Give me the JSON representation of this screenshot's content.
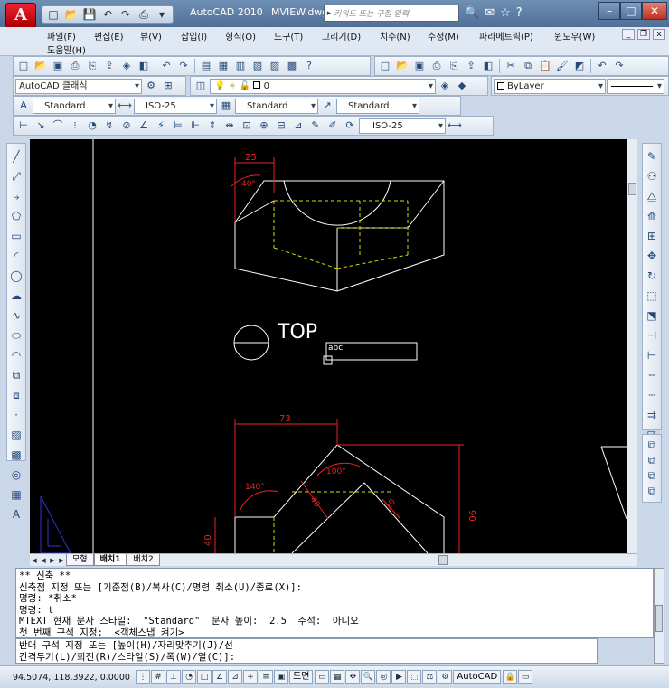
{
  "window": {
    "app_title": "AutoCAD 2010",
    "file_name": "MVIEW.dwg",
    "search_placeholder": "키워드 또는 구절 입력"
  },
  "menu": {
    "items": [
      "파일(F)",
      "편집(E)",
      "뷰(V)",
      "삽입(I)",
      "형식(O)",
      "도구(T)",
      "그리기(D)",
      "치수(N)",
      "수정(M)",
      "파라메트릭(P)",
      "윈도우(W)",
      "도움말(H)"
    ]
  },
  "toolbars": {
    "workspace": "AutoCAD 클래식",
    "layer": "0",
    "color": "ByLayer",
    "text_style": "Standard",
    "dim_style": "ISO-25",
    "table_style": "Standard",
    "multileader_style": "Standard",
    "dim_style_2": "ISO-25"
  },
  "drawing": {
    "view_label": "TOP",
    "text_label": "abc",
    "dims": {
      "top_width": "25",
      "top_angle": "40°",
      "bottom_width": "73",
      "angle_140": "140°",
      "angle_100": "100°",
      "dim_40": "40",
      "dim_20": "20",
      "dim_90": "90",
      "dim_40_left": "40"
    }
  },
  "layout_tabs": [
    "모형",
    "배치1",
    "배치2"
  ],
  "command_history": [
    "** 신축 **",
    "신축점 지정 또는 [기준점(B)/복사(C)/명령 취소(U)/종료(X)]:",
    "명령: *취소*",
    "명령: t",
    "MTEXT 현재 문자 스타일:  \"Standard\"  문자 높이:  2.5  주석:  아니오",
    "첫 번째 구석 지정:  <객체스냅 켜기>"
  ],
  "command_prompt": [
    "반대 구석 지정 또는 [높이(H)/자리맞추기(J)/선",
    "간격두기(L)/회전(R)/스타일(S)/폭(W)/열(C)]:"
  ],
  "status": {
    "coords": "94.5074,  118.3922, 0.0000",
    "paper_label": "도면",
    "workspace_label": "AutoCAD"
  }
}
